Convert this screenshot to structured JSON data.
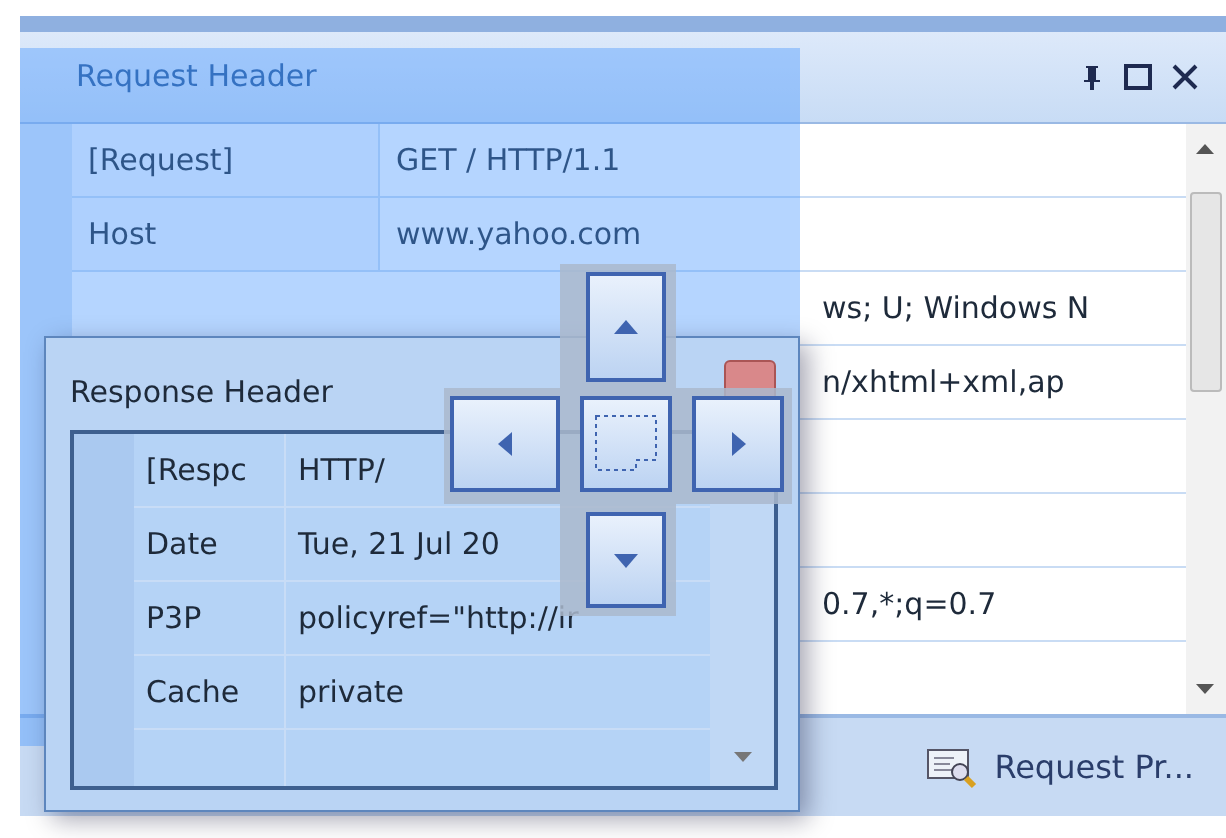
{
  "request_header": {
    "title": "Request Header",
    "rows": [
      {
        "name": "[Request]",
        "value": "GET / HTTP/1.1"
      },
      {
        "name": "Host",
        "value": "www.yahoo.com"
      },
      {
        "value": "ws; U; Windows N"
      },
      {
        "value": "n/xhtml+xml,ap"
      },
      {},
      {},
      {
        "value": "0.7,*;q=0.7"
      },
      {}
    ]
  },
  "tabs": [
    {
      "label": "Request Pr..."
    }
  ],
  "response_header": {
    "title": "Response Header",
    "rows": [
      {
        "name": "[Respc",
        "value": "HTTP/"
      },
      {
        "name": "Date",
        "value": "Tue, 21 Jul 20"
      },
      {
        "name": "P3P",
        "value": "policyref=\"http://ir"
      },
      {
        "name": "Cache",
        "value": "private"
      },
      {}
    ]
  }
}
